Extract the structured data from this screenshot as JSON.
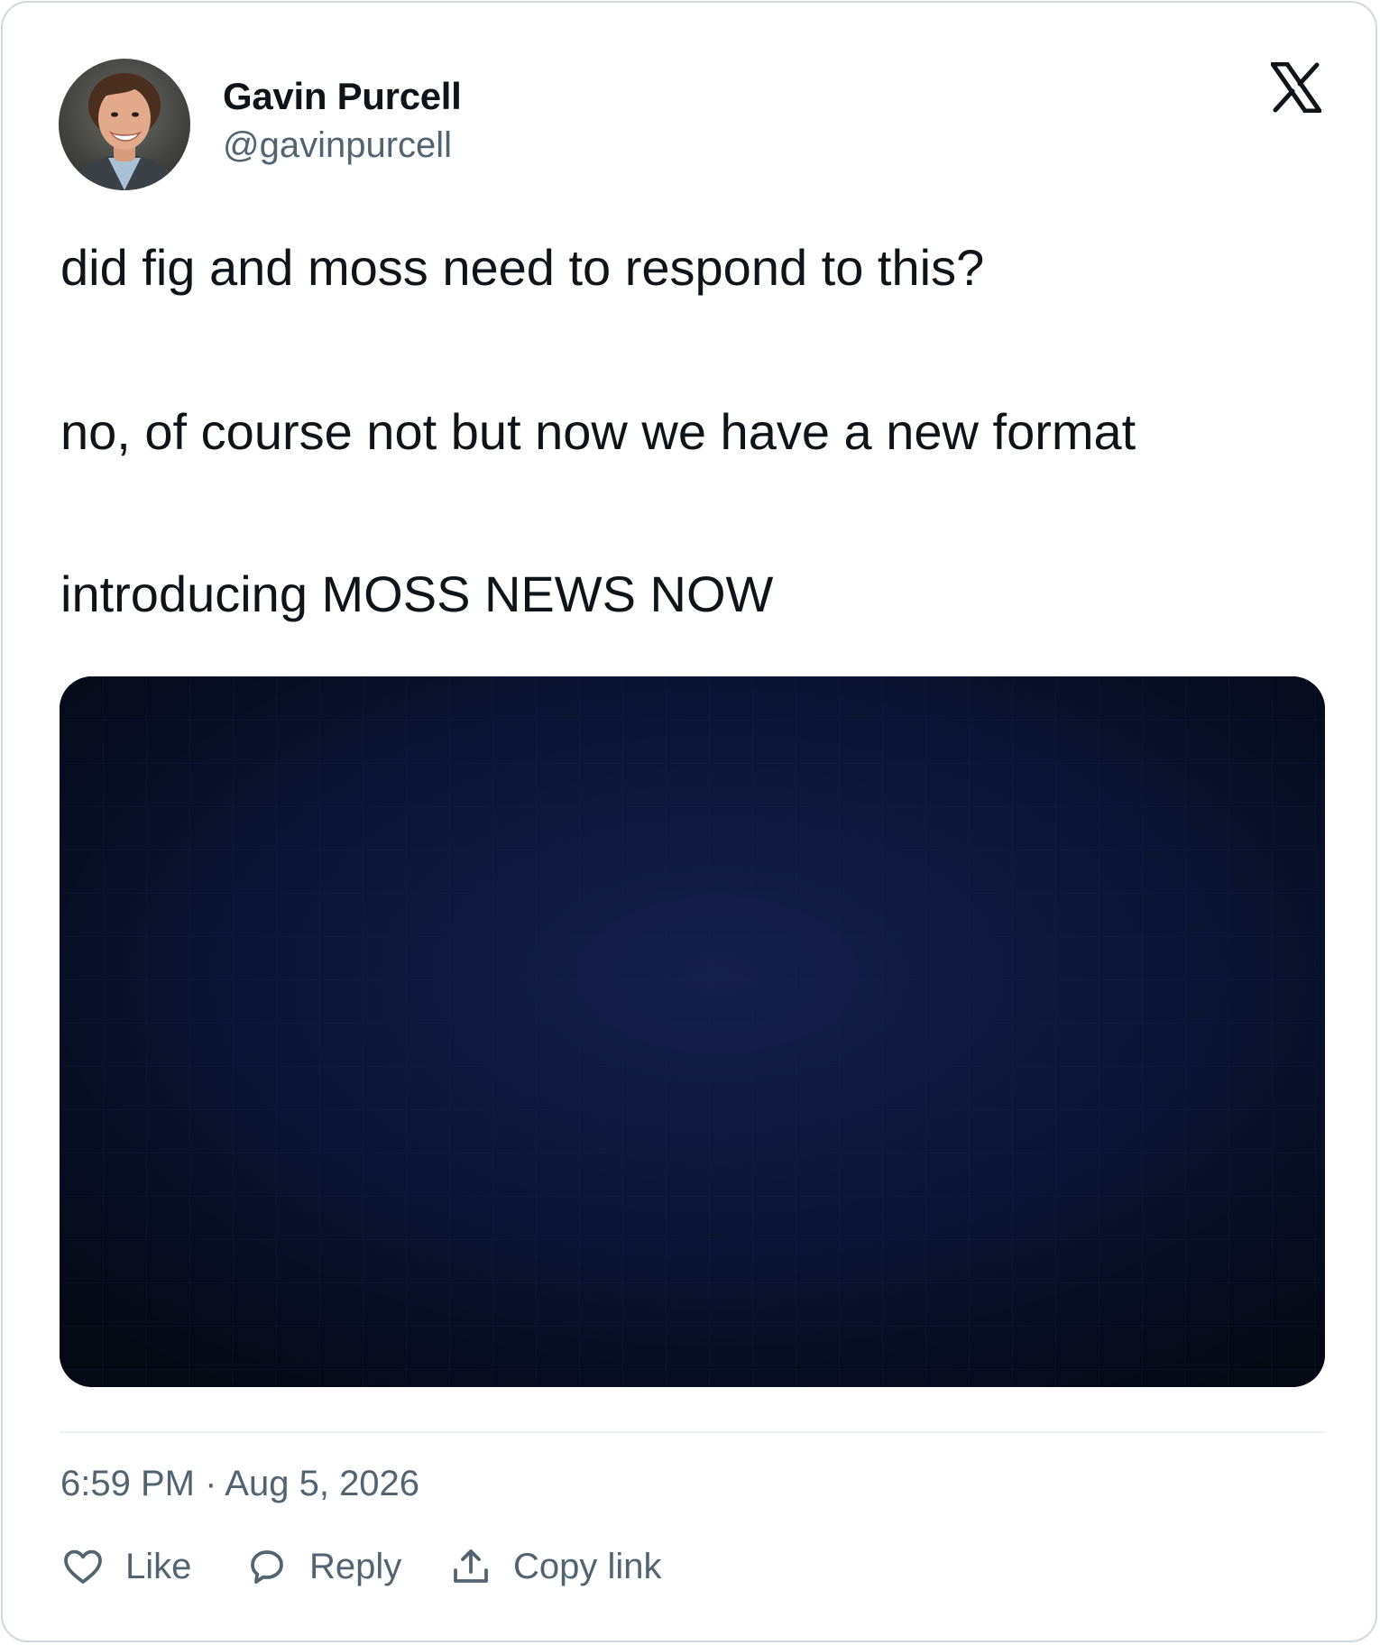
{
  "author": {
    "name": "Gavin Purcell",
    "handle": "@gavinpurcell"
  },
  "brand_icon": "x-logo-icon",
  "tweet": {
    "lines": [
      "did fig and moss need to respond to this?",
      "no, of course not but now we have a new format",
      "introducing MOSS NEWS NOW"
    ]
  },
  "media": {
    "type": "video-thumbnail",
    "colors": {
      "center": "#141f4a",
      "edge": "#050914"
    }
  },
  "timestamp": "6:59 PM · Aug 5, 2026",
  "actions": [
    {
      "label": "Like",
      "icon": "heart-icon"
    },
    {
      "label": "Reply",
      "icon": "speech-bubble-icon"
    },
    {
      "label": "Copy link",
      "icon": "share-upload-icon"
    }
  ],
  "colors": {
    "text_primary": "#0f1419",
    "text_secondary": "#536471",
    "border": "#cfd9de"
  }
}
